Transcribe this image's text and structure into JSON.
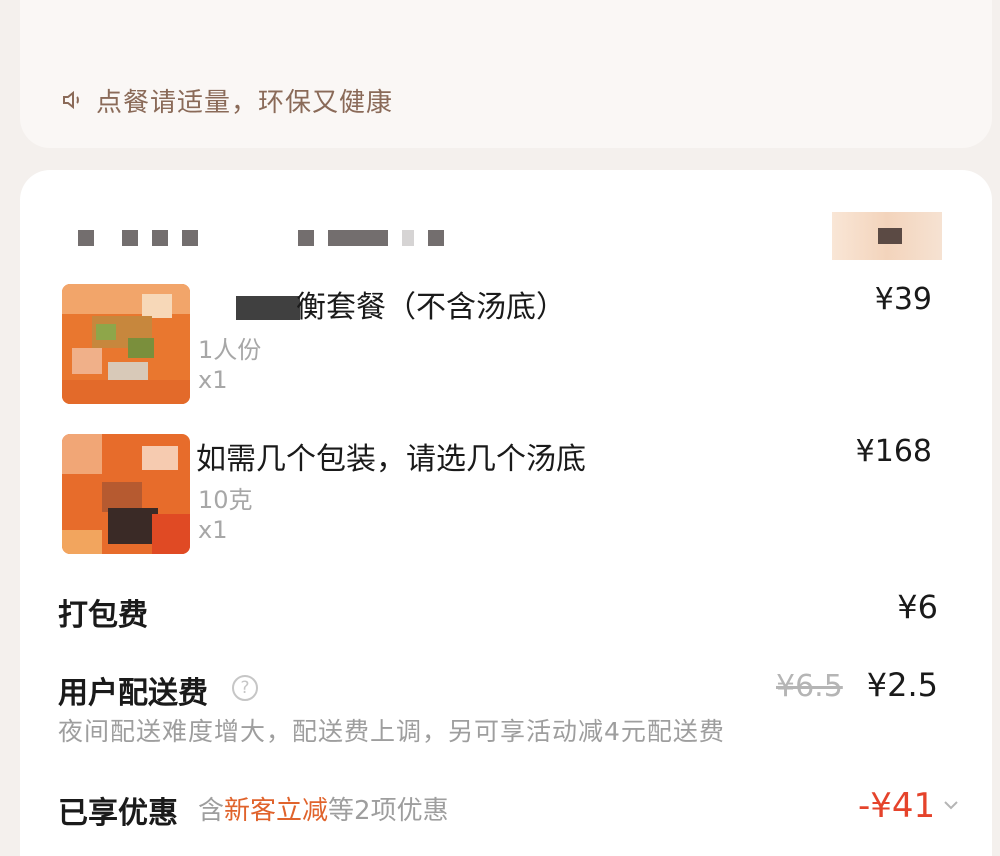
{
  "notice": {
    "icon": "speaker-icon",
    "text": "点餐请适量，环保又健康"
  },
  "items": [
    {
      "name": "衡套餐（不含汤底）",
      "spec": "1人份",
      "qty": "x1",
      "price": "¥39"
    },
    {
      "name": "如需几个包装，请选几个汤底",
      "spec": "10克",
      "qty": "x1",
      "price": "¥168"
    }
  ],
  "packing_fee": {
    "label": "打包费",
    "value": "¥6"
  },
  "delivery_fee": {
    "label": "用户配送费",
    "original": "¥6.5",
    "value": "¥2.5",
    "note": "夜间配送难度增大，配送费上调，另可享活动减4元配送费"
  },
  "promotions": {
    "label": "已享优惠",
    "note_prefix": "含",
    "note_highlight": "新客立减",
    "note_suffix": "等2项优惠",
    "value": "-¥41"
  },
  "colors": {
    "discount": "#e5432b",
    "highlight": "#e0632c",
    "notice": "#8a6a58"
  }
}
